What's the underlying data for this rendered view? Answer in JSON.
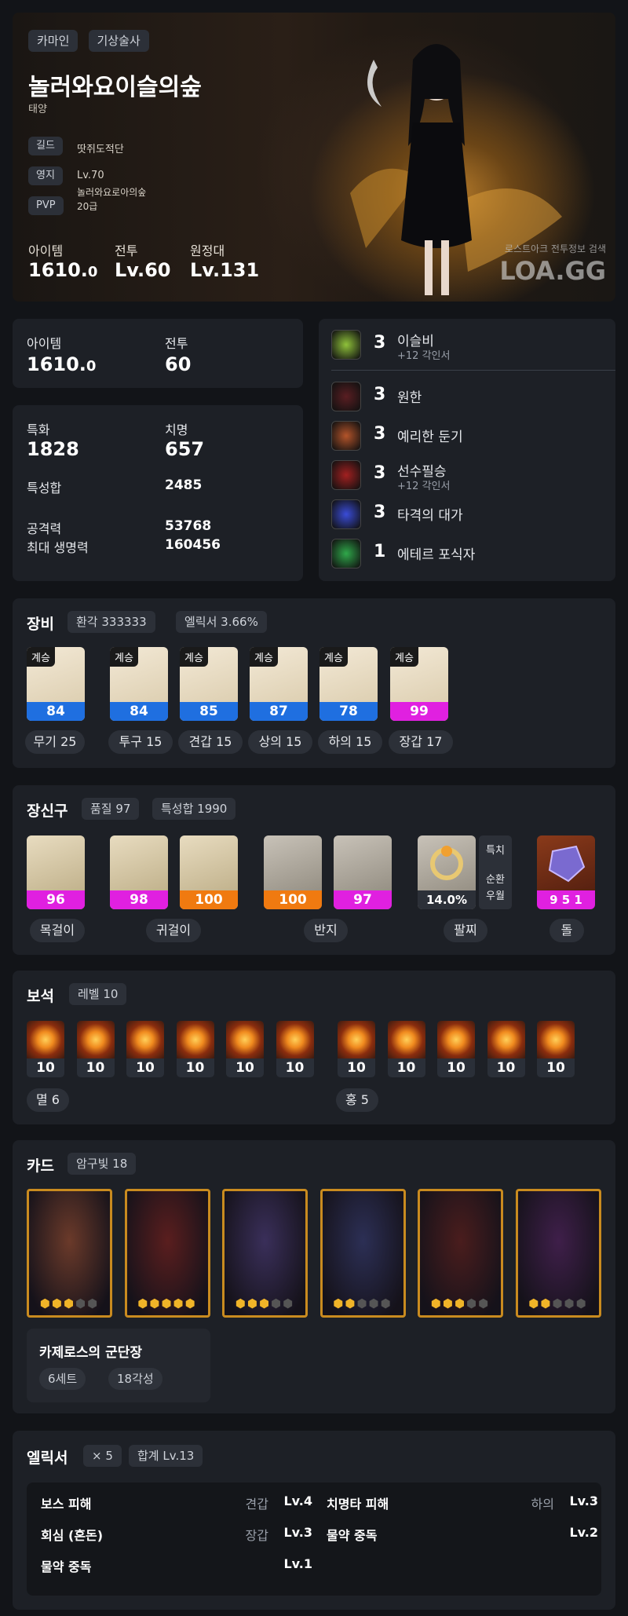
{
  "hero": {
    "server": "카마인",
    "class": "기상술사",
    "name": "놀러와요이슬의숲",
    "title": "태양",
    "guild_label": "길드",
    "guild_value": "땃쥐도적단",
    "estate_label": "영지",
    "estate_level": "Lv.70",
    "estate_name": "놀러와요로아의숲",
    "pvp_label": "PVP",
    "pvp_value": "20급",
    "item_label": "아이템",
    "item_value": "1610.",
    "item_decimal": "0",
    "combat_label": "전투",
    "combat_value": "Lv.60",
    "expedition_label": "원정대",
    "expedition_value": "Lv.131",
    "watermark_sub": "로스트아크 전투정보 검색",
    "watermark_logo": "LOA.GG"
  },
  "summary": {
    "item_label": "아이템",
    "item_value": "1610.",
    "item_decimal": "0",
    "combat_label": "전투",
    "combat_value": "60"
  },
  "stats": {
    "spec_label": "특화",
    "spec_value": "1828",
    "crit_label": "치명",
    "crit_value": "657",
    "total_label": "특성합",
    "total_value": "2485",
    "atk_label": "공격력",
    "atk_value": "53768",
    "hp_label": "최대 생명력",
    "hp_value": "160456"
  },
  "engravings": [
    {
      "level": "3",
      "name": "이슬비",
      "sub": "+12 각인서",
      "icon_color": "#8fc23a"
    },
    {
      "level": "3",
      "name": "원한",
      "sub": "",
      "icon_color": "#5a1e22"
    },
    {
      "level": "3",
      "name": "예리한 둔기",
      "sub": "",
      "icon_color": "#b4542a"
    },
    {
      "level": "3",
      "name": "선수필승",
      "sub": "+12 각인서",
      "icon_color": "#a22020"
    },
    {
      "level": "3",
      "name": "타격의 대가",
      "sub": "",
      "icon_color": "#3a4cd8"
    },
    {
      "level": "1",
      "name": "에테르 포식자",
      "sub": "",
      "icon_color": "#2fa84a"
    }
  ],
  "equipment": {
    "title": "장비",
    "chip_1": "환각 333333",
    "chip_2": "엘릭서 3.66%",
    "items": [
      {
        "tag": "계승",
        "quality": "84",
        "label": "무기 25",
        "icon": "weapon-icon",
        "qcolor": "#1f6fe0"
      },
      {
        "tag": "계승",
        "quality": "84",
        "label": "투구 15",
        "icon": "helmet-icon",
        "qcolor": "#1f6fe0"
      },
      {
        "tag": "계승",
        "quality": "85",
        "label": "견갑 15",
        "icon": "shoulder-icon",
        "qcolor": "#1f6fe0"
      },
      {
        "tag": "계승",
        "quality": "87",
        "label": "상의 15",
        "icon": "chest-icon",
        "qcolor": "#1f6fe0"
      },
      {
        "tag": "계승",
        "quality": "78",
        "label": "하의 15",
        "icon": "pants-icon",
        "qcolor": "#1f6fe0"
      },
      {
        "tag": "계승",
        "quality": "99",
        "label": "장갑 17",
        "icon": "gloves-icon",
        "qcolor": "#e020e0"
      }
    ]
  },
  "accessories": {
    "title": "장신구",
    "chip_1": "품질 97",
    "chip_2": "특성합 1990",
    "items": [
      {
        "quality": "96",
        "qcolor": "#e020e0",
        "icon": "necklace-icon"
      },
      {
        "quality": "98",
        "qcolor": "#e020e0",
        "icon": "earring-icon"
      },
      {
        "quality": "100",
        "qcolor": "#f07a10",
        "icon": "earring-icon"
      },
      {
        "quality": "100",
        "qcolor": "#f07a10",
        "icon": "ring-icon"
      },
      {
        "quality": "97",
        "qcolor": "#e020e0",
        "icon": "ring-icon"
      }
    ],
    "bracelet_value": "14.0%",
    "bracelet_tag_1": "특치",
    "bracelet_tag_2": "순환",
    "bracelet_tag_3": "우월",
    "stone_value": "9 5 1",
    "labels": {
      "necklace": "목걸이",
      "earring": "귀걸이",
      "ring": "반지",
      "bracelet": "팔찌",
      "stone": "돌"
    }
  },
  "gems": {
    "title": "보석",
    "chip": "레벨 10",
    "left_levels": [
      "10",
      "10",
      "10",
      "10",
      "10",
      "10"
    ],
    "right_levels": [
      "10",
      "10",
      "10",
      "10",
      "10"
    ],
    "left_label": "멸 6",
    "right_label": "홍 5"
  },
  "cards": {
    "title": "카드",
    "chip": "암구빛 18",
    "set_name": "카제로스의 군단장",
    "set_chip_1": "6세트",
    "set_chip_2": "18각성",
    "items": [
      {
        "awaken": 3,
        "bg": "#6b3a2a"
      },
      {
        "awaken": 5,
        "bg": "#5a1e1e"
      },
      {
        "awaken": 3,
        "bg": "#3a2f5a"
      },
      {
        "awaken": 2,
        "bg": "#2c2f55"
      },
      {
        "awaken": 3,
        "bg": "#4a1d1d"
      },
      {
        "awaken": 2,
        "bg": "#3f1f4a"
      }
    ]
  },
  "elixir": {
    "title": "엘릭서",
    "chip_1": "× 5",
    "chip_2": "합계 Lv.13",
    "rows": [
      {
        "name": "보스 피해",
        "slot": "견갑",
        "lv": "Lv.4"
      },
      {
        "name": "치명타 피해",
        "slot": "하의",
        "lv": "Lv.3"
      },
      {
        "name": "회심 (혼돈)",
        "slot": "장갑",
        "lv": "Lv.3"
      },
      {
        "name": "물약 중독",
        "slot": "",
        "lv": "Lv.2"
      },
      {
        "name": "물약 중독",
        "slot": "",
        "lv": "Lv.1"
      }
    ]
  }
}
